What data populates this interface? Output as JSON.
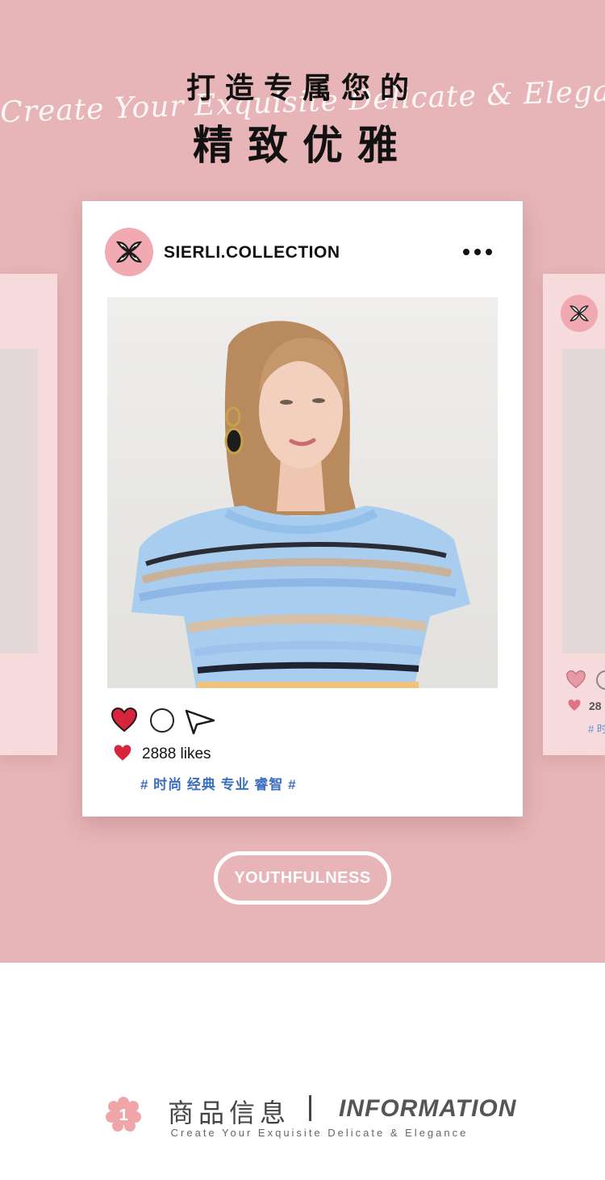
{
  "hero": {
    "title_line_1": "打造专属您的",
    "script_line": "Create Your Exquisite Delicate & Elegance",
    "title_line_2": "精致优雅",
    "background_color": "#e7b5b7"
  },
  "post": {
    "account_name": "SIERLI.COLLECTION",
    "more_icon": "more-dots-icon",
    "likes_count": "2888 likes",
    "hashtags": "# 时尚 经典 专业 睿智 #",
    "icons": [
      "heart-icon",
      "comment-icon",
      "share-icon"
    ]
  },
  "side_card_right": {
    "likes_partial": "28",
    "tag_partial": "# 时"
  },
  "cta": {
    "label": "YOUTHFULNESS"
  },
  "info": {
    "number": "1",
    "title_cn": "商品信息",
    "title_en": "INFORMATION",
    "subtitle": "Create Your Exquisite Delicate & Elegance"
  },
  "colors": {
    "accent_pink": "#e7b5b7",
    "heart_red": "#d7253b",
    "hashtag_blue": "#3d6fc0"
  }
}
